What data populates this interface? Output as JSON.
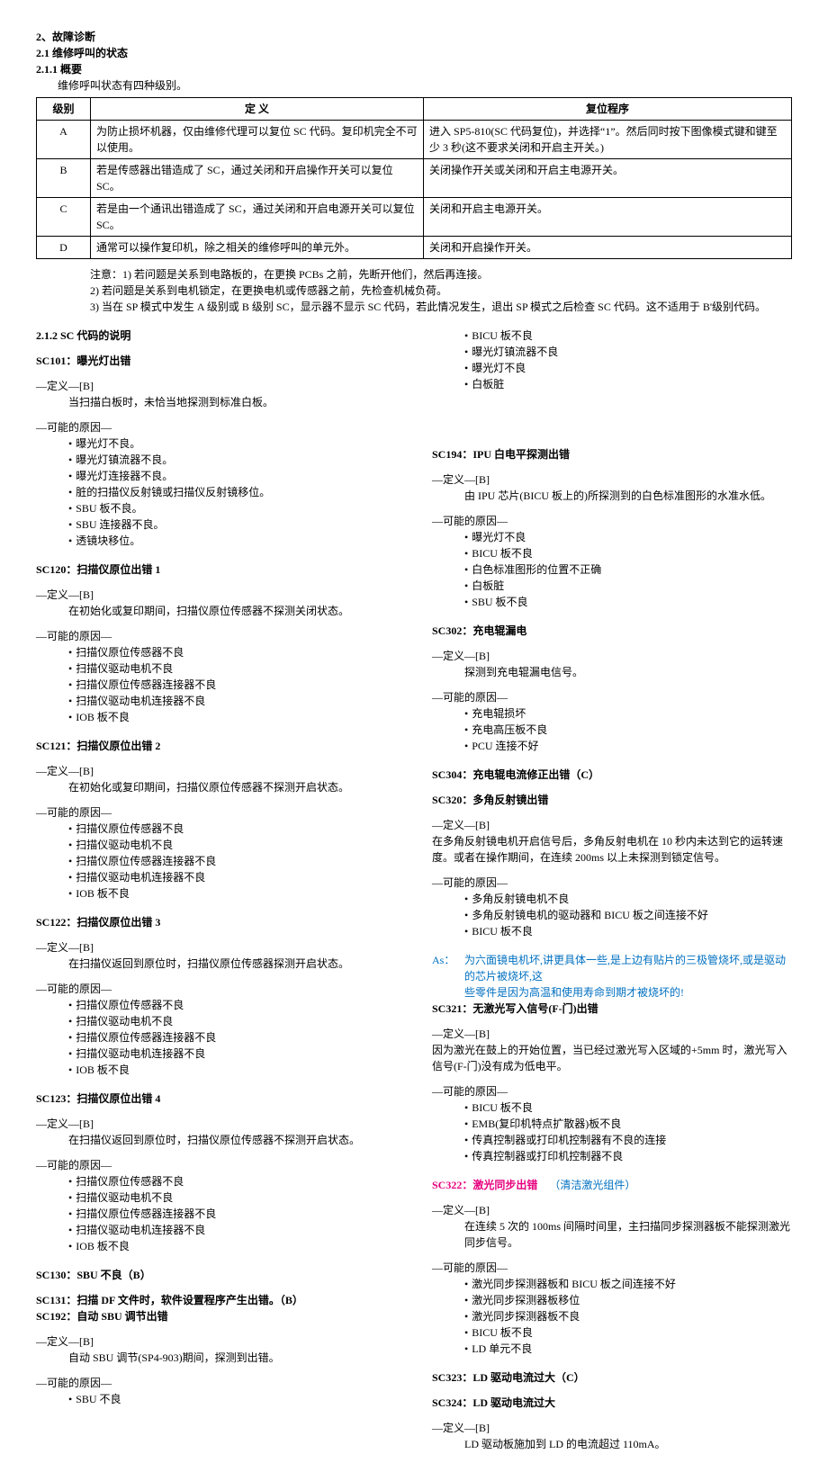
{
  "header": {
    "l1": "2、故障诊断",
    "l2": "2.1  维修呼叫的状态",
    "l3": "2.1.1  概要",
    "intro": "维修呼叫状态有四种级别。"
  },
  "table": {
    "h1": "级别",
    "h2": "定  义",
    "h3": "复位程序",
    "rows": [
      {
        "a": "A",
        "b": "为防止损坏机器，仅由维修代理可以复位 SC 代码。复印机完全不可以使用。",
        "c": "进入 SP5-810(SC 代码复位)，并选择“1”。然后同时按下图像模式键和键至少 3 秒(这不要求关闭和开启主开关。)"
      },
      {
        "a": "B",
        "b": "若是传感器出错造成了 SC，通过关闭和开启操作开关可以复位 SC。",
        "c": "关闭操作开关或关闭和开启主电源开关。"
      },
      {
        "a": "C",
        "b": "若是由一个通讯出错造成了 SC，通过关闭和开启电源开关可以复位 SC。",
        "c": "关闭和开启主电源开关。"
      },
      {
        "a": "D",
        "b": "通常可以操作复印机，除之相关的维修呼叫的单元外。",
        "c": "关闭和开启操作开关。"
      }
    ]
  },
  "notes": {
    "n1": "注意：1) 若问题是关系到电路板的，在更换 PCBs 之前，先断开他们，然后再连接。",
    "n2": "2) 若问题是关系到电机锁定，在更换电机或传感器之前，先检查机械负荷。",
    "n3": "3) 当在 SP 模式中发生 A 级别或 B 级别 SC，显示器不显示 SC 代码，若此情况发生，退出 SP 模式之后检查 SC 代码。这不适用于 B'级别代码。"
  },
  "sectionTitle": "2.1.2  SC 代码的说明",
  "def_label": "—定义—[B]",
  "cause_label": "—可能的原因—",
  "sc101": {
    "title": "SC101：曝光灯出错",
    "def": "当扫描白板时，未恰当地探测到标准白板。",
    "causes": [
      "曝光灯不良。",
      "曝光灯镇流器不良。",
      "曝光灯连接器不良。",
      "脏的扫描仪反射镜或扫描仪反射镜移位。",
      "SBU 板不良。",
      "SBU 连接器不良。",
      "透镜块移位。"
    ]
  },
  "sc120": {
    "title": "SC120：扫描仪原位出错 1",
    "def": "在初始化或复印期间，扫描仪原位传感器不探测关闭状态。",
    "causes": [
      "扫描仪原位传感器不良",
      "扫描仪驱动电机不良",
      "扫描仪原位传感器连接器不良",
      "扫描仪驱动电机连接器不良",
      "IOB 板不良"
    ]
  },
  "sc121": {
    "title": "SC121：扫描仪原位出错 2",
    "def": "在初始化或复印期间，扫描仪原位传感器不探测开启状态。",
    "causes": [
      "扫描仪原位传感器不良",
      "扫描仪驱动电机不良",
      "扫描仪原位传感器连接器不良",
      "扫描仪驱动电机连接器不良",
      "IOB 板不良"
    ]
  },
  "sc122": {
    "title": "SC122：扫描仪原位出错 3",
    "def": "在扫描仪返回到原位时，扫描仪原位传感器探测开启状态。",
    "causes": [
      "扫描仪原位传感器不良",
      "扫描仪驱动电机不良",
      "扫描仪原位传感器连接器不良",
      "扫描仪驱动电机连接器不良",
      "IOB 板不良"
    ]
  },
  "sc123": {
    "title": "SC123：扫描仪原位出错 4",
    "def": "在扫描仪返回到原位时，扫描仪原位传感器不探测开启状态。",
    "causes": [
      "扫描仪原位传感器不良",
      "扫描仪驱动电机不良",
      "扫描仪原位传感器连接器不良",
      "扫描仪驱动电机连接器不良",
      "IOB 板不良"
    ]
  },
  "sc130": {
    "title": "SC130：SBU 不良（B）"
  },
  "sc131": {
    "title": "SC131：扫描 DF 文件时，软件设置程序产生出错。（B）"
  },
  "sc192": {
    "title": "SC192：自动 SBU 调节出错",
    "def": "自动 SBU 调节(SP4-903)期间，探测到出错。",
    "causes": [
      "SBU 不良"
    ]
  },
  "sc192_extra": [
    "BICU 板不良",
    "曝光灯镇流器不良",
    "曝光灯不良",
    "白板脏"
  ],
  "sc194": {
    "title": "SC194：IPU 白电平探测出错",
    "def": "由 IPU 芯片(BICU 板上的)所探测到的白色标准图形的水准水低。",
    "causes": [
      "曝光灯不良",
      "BICU 板不良",
      "白色标准图形的位置不正确",
      "白板脏",
      "SBU 板不良"
    ]
  },
  "sc302": {
    "title": "SC302：充电辊漏电",
    "def": "探测到充电辊漏电信号。",
    "causes": [
      "充电辊损坏",
      "充电高压板不良",
      "PCU 连接不好"
    ]
  },
  "sc304": {
    "title": "SC304：充电辊电流修正出错（C）"
  },
  "sc320": {
    "title": "SC320：多角反射镜出错",
    "def": "在多角反射镜电机开启信号后，多角反射电机在 10 秒内未达到它的运转速度。或者在操作期间，在连续 200ms 以上未探测到锁定信号。",
    "causes": [
      "多角反射镜电机不良",
      "多角反射镜电机的驱动器和 BICU 板之间连接不好",
      "BICU 板不良"
    ]
  },
  "as_note": {
    "label": "As：",
    "line1": "为六面镜电机坏,讲更具体一些,是上边有贴片的三极管烧坏,或是驱动的芯片被烧坏,这",
    "line2": "些零件是因为高温和使用寿命到期才被烧坏的!"
  },
  "sc321": {
    "title": "SC321：无激光写入信号(F-门)出错",
    "def": "因为激光在鼓上的开始位置，当已经过激光写入区域的+5mm 时，激光写入信号(F-门)没有成为低电平。",
    "causes": [
      "BICU 板不良",
      "EMB(复印机特点扩散器)板不良",
      "传真控制器或打印机控制器有不良的连接",
      "传真控制器或打印机控制器不良"
    ]
  },
  "sc322": {
    "title": "SC322：激光同步出错",
    "note": "（清洁激光组件）",
    "def": "在连续 5 次的 100ms 间隔时间里，主扫描同步探测器板不能探测激光同步信号。",
    "causes": [
      "激光同步探测器板和 BICU 板之间连接不好",
      "激光同步探测器板移位",
      "激光同步探测器板不良",
      "BICU 板不良",
      "LD 单元不良"
    ]
  },
  "sc323": {
    "title": "SC323：LD 驱动电流过大（C）"
  },
  "sc324": {
    "title": "SC324：LD 驱动电流过大",
    "def": "LD 驱动板施加到 LD 的电流超过 110mA。"
  }
}
